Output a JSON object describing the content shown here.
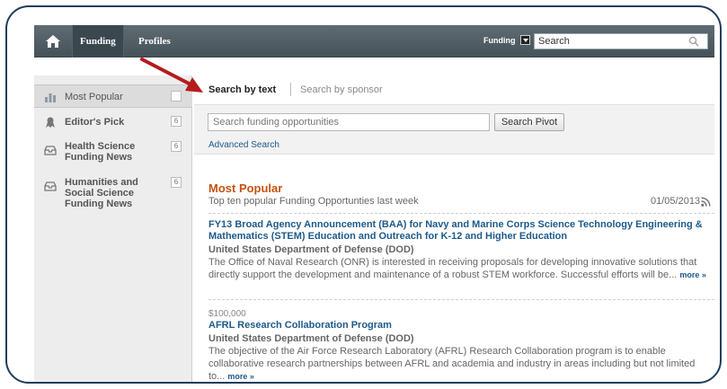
{
  "nav": {
    "tabs": [
      {
        "label": "Funding",
        "active": true
      },
      {
        "label": "Profiles",
        "active": false
      }
    ],
    "scope_label": "Funding",
    "search_value": "Search"
  },
  "sidebar": {
    "items": [
      {
        "label": "Most Popular",
        "badge": "",
        "icon": "bar-chart-icon",
        "active": true
      },
      {
        "label": "Editor's Pick",
        "badge": "6",
        "icon": "award-ribbon-icon",
        "active": false
      },
      {
        "label": "Health Science Funding News",
        "badge": "6",
        "icon": "tray-icon",
        "active": false
      },
      {
        "label": "Humanities and Social Science Funding News",
        "badge": "6",
        "icon": "tray-icon",
        "active": false
      }
    ]
  },
  "search": {
    "tab_active": "Search by text",
    "tab_inactive": "Search by sponsor",
    "placeholder": "Search funding opportunities",
    "button_label": "Search Pivot",
    "advanced_link": "Advanced Search"
  },
  "most_popular": {
    "heading": "Most Popular",
    "subtitle": "Top ten popular Funding Opportunties last week",
    "date": "01/05/2013",
    "items": [
      {
        "amount": "",
        "title": "FY13 Broad Agency Announcement (BAA) for Navy and Marine Corps Science Technology Engineering & Mathematics (STEM) Education and Outreach for K-12 and Higher Education",
        "sponsor": "United States Department of Defense (DOD)",
        "description": "The Office of Naval Research (ONR) is interested in receiving proposals for developing innovative solutions that directly support the development and maintenance of a robust STEM workforce. Successful efforts will be...",
        "more_label": "more »"
      },
      {
        "amount": "$100,000",
        "title": "AFRL Research Collaboration Program",
        "sponsor": "United States Department of Defense (DOD)",
        "description": "The objective of the Air Force Research Laboratory (AFRL) Research Collaboration program is to enable collaborative research partnerships between AFRL and academia and industry in areas including but not limited to...",
        "more_label": "more »"
      }
    ]
  },
  "colors": {
    "topbar": "#4f5b63",
    "heading_orange": "#c4520f",
    "link_blue": "#1e5a8a",
    "annotation_arrow": "#b51c1c",
    "frame_border": "#1f3d5c"
  }
}
